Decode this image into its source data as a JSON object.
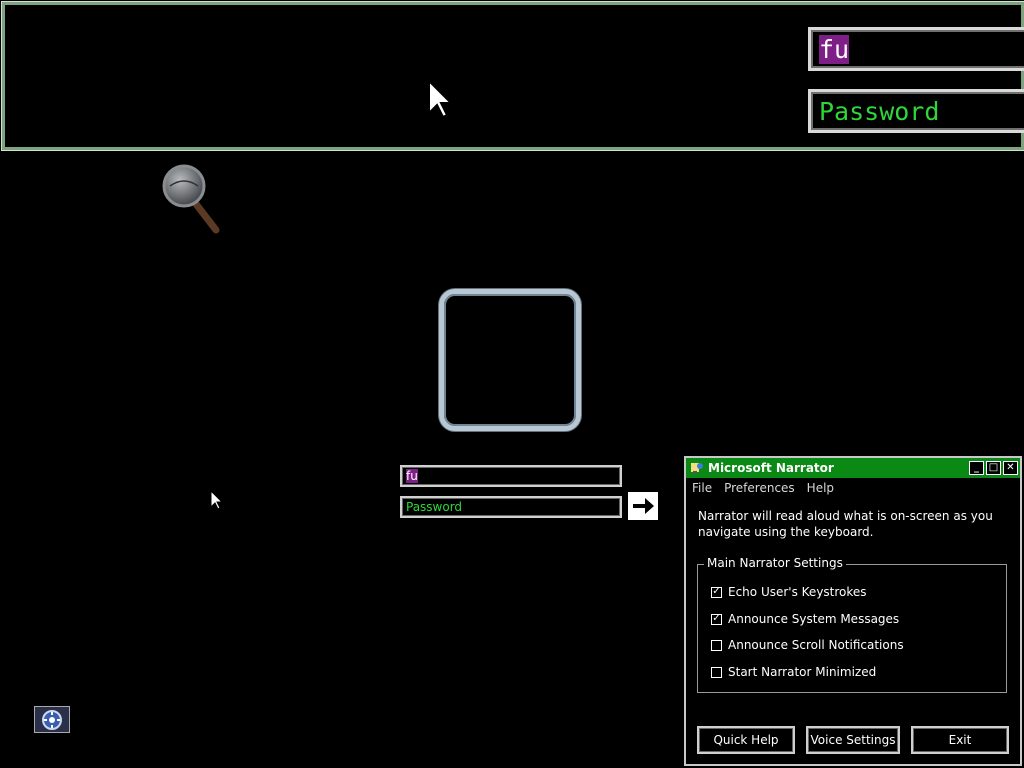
{
  "magnifier": {
    "username_value": "fu",
    "password_placeholder": "Password"
  },
  "login": {
    "username_value": "fu",
    "password_placeholder": "Password",
    "submit_icon": "arrow-right-icon"
  },
  "narrator": {
    "title": "Microsoft Narrator",
    "menu": [
      "File",
      "Preferences",
      "Help"
    ],
    "description": "Narrator will read aloud what is on-screen as you navigate using the keyboard.",
    "group_label": "Main Narrator Settings",
    "options": [
      {
        "label": "Echo User's Keystrokes",
        "checked": true
      },
      {
        "label": "Announce System Messages",
        "checked": true
      },
      {
        "label": "Announce Scroll Notifications",
        "checked": false
      },
      {
        "label": "Start Narrator Minimized",
        "checked": false
      }
    ],
    "buttons": {
      "quick_help": "Quick Help",
      "voice_settings": "Voice Settings",
      "exit": "Exit"
    }
  },
  "colors": {
    "narrator_titlebar": "#0a8a14",
    "password_text": "#2fd63a",
    "selection": "#7d1f86"
  }
}
